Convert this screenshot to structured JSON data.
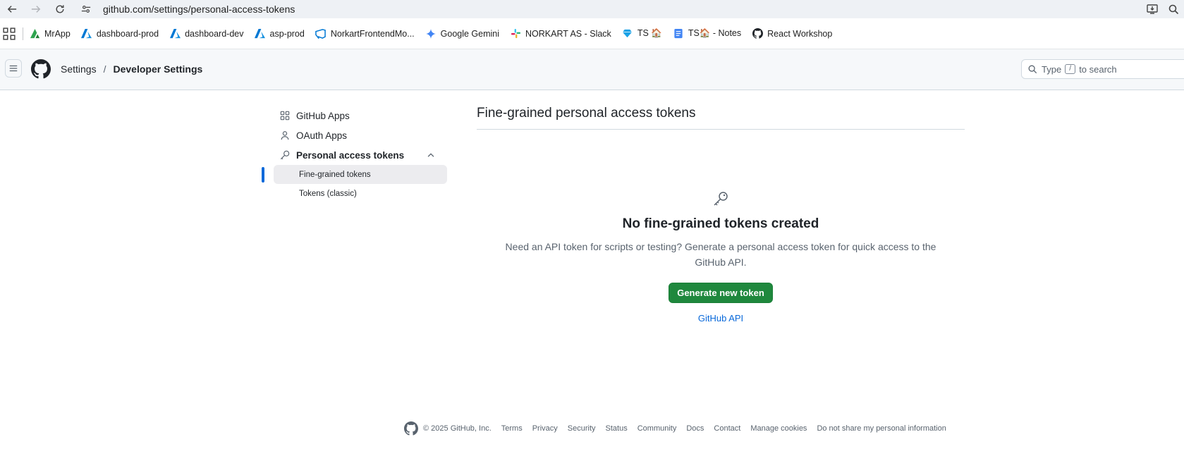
{
  "browser": {
    "url": "github.com/settings/personal-access-tokens",
    "bookmarks": [
      {
        "label": "MrApp",
        "icon": "mrapp-icon",
        "color": "#2ea44f"
      },
      {
        "label": "dashboard-prod",
        "icon": "azure-icon",
        "color": "#0078d4"
      },
      {
        "label": "dashboard-dev",
        "icon": "azure-icon",
        "color": "#0078d4"
      },
      {
        "label": "asp-prod",
        "icon": "azure-icon",
        "color": "#0078d4"
      },
      {
        "label": "NorkartFrontendMo...",
        "icon": "azure-devops-icon",
        "color": "#0078d4"
      },
      {
        "label": "Google Gemini",
        "icon": "gemini-icon",
        "color": "#4285f4"
      },
      {
        "label": "NORKART AS - Slack",
        "icon": "slack-icon",
        "color": "#e01e5a"
      },
      {
        "label": "TS 🏠",
        "icon": "gem-icon",
        "color": "#19a1e6"
      },
      {
        "label": "TS🏠 - Notes",
        "icon": "notes-icon",
        "color": "#4285f4"
      },
      {
        "label": "React Workshop",
        "icon": "github-icon",
        "color": "#1f2328"
      }
    ]
  },
  "header": {
    "breadcrumb_root": "Settings",
    "breadcrumb_separator": "/",
    "breadcrumb_current": "Developer Settings",
    "search_prefix": "Type",
    "search_key": "/",
    "search_suffix": "to search"
  },
  "sidebar": {
    "items": [
      {
        "label": "GitHub Apps",
        "icon": "apps-icon"
      },
      {
        "label": "OAuth Apps",
        "icon": "person-icon"
      },
      {
        "label": "Personal access tokens",
        "icon": "key-icon"
      }
    ],
    "subitems": [
      {
        "label": "Fine-grained tokens",
        "active": true
      },
      {
        "label": "Tokens (classic)",
        "active": false
      }
    ]
  },
  "main": {
    "title": "Fine-grained personal access tokens",
    "blankslate": {
      "heading": "No fine-grained tokens created",
      "description": "Need an API token for scripts or testing? Generate a personal access token for quick access to the GitHub API.",
      "button": "Generate new token",
      "link": "GitHub API"
    }
  },
  "footer": {
    "copyright": "© 2025 GitHub, Inc.",
    "links": [
      "Terms",
      "Privacy",
      "Security",
      "Status",
      "Community",
      "Docs",
      "Contact",
      "Manage cookies",
      "Do not share my personal information"
    ]
  },
  "colors": {
    "accent": "#0969da",
    "primary_button": "#1f883d"
  }
}
